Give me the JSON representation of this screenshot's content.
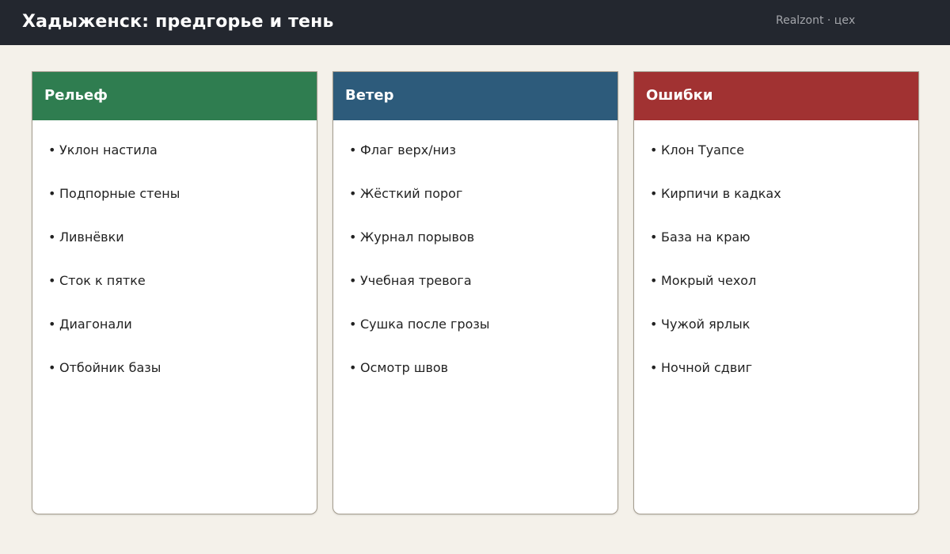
{
  "header": {
    "title": "Хадыженск: предгорье и тень",
    "brand": "Realzont · цех"
  },
  "columns": [
    {
      "title": "Рельеф",
      "color": "#2f7d50",
      "items": [
        "Уклон настила",
        "Подпорные стены",
        "Ливнёвки",
        "Сток к пятке",
        "Диагонали",
        "Отбойник базы"
      ]
    },
    {
      "title": "Ветер",
      "color": "#2d5b7b",
      "items": [
        "Флаг верх/низ",
        "Жёсткий порог",
        "Журнал порывов",
        "Учебная тревога",
        "Сушка после грозы",
        "Осмотр швов"
      ]
    },
    {
      "title": "Ошибки",
      "color": "#a13232",
      "items": [
        "Клон Туапсе",
        "Кирпичи в кадках",
        "База на краю",
        "Мокрый чехол",
        "Чужой ярлык",
        "Ночной сдвиг"
      ]
    }
  ],
  "bullet": "•"
}
